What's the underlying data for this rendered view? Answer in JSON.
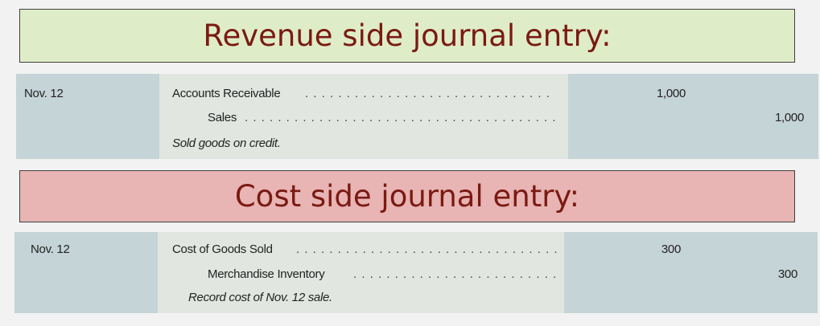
{
  "revenue": {
    "heading": "Revenue side journal entry:",
    "date": "Nov. 12",
    "debit_account": "Accounts Receivable",
    "credit_account": "Sales",
    "explanation": "Sold goods on credit.",
    "debit_amount": "1,000",
    "credit_amount": "1,000"
  },
  "cost": {
    "heading": "Cost side journal entry:",
    "date": "Nov. 12",
    "debit_account": "Cost of Goods Sold",
    "credit_account": "Merchandise Inventory",
    "explanation": "Record cost of Nov. 12 sale.",
    "debit_amount": "300",
    "credit_amount": "300"
  }
}
